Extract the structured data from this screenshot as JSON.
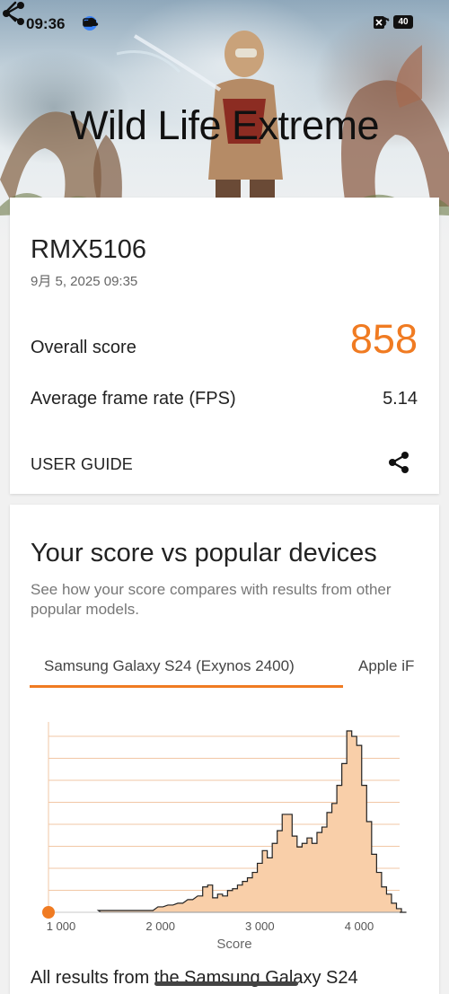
{
  "status_bar": {
    "time": "09:36",
    "left_badge": "GT",
    "right_gt": "GT",
    "battery": "40",
    "icons": [
      "video-camera-icon",
      "gt-badge-icon",
      "cloud-icon",
      "vibrate-icon",
      "wifi-icon",
      "sim-off-icon",
      "battery-icon"
    ]
  },
  "hero": {
    "title": "Wild Life Extreme"
  },
  "result_card": {
    "device": "RMX5106",
    "date": "9月 5, 2025 09:35",
    "overall_label": "Overall score",
    "overall_value": "858",
    "fps_label": "Average frame rate (FPS)",
    "fps_value": "5.14",
    "user_guide": "USER GUIDE"
  },
  "compare_card": {
    "title": "Your score vs popular devices",
    "subtitle": "See how your score compares with results from other popular models.",
    "tabs": [
      "Samsung Galaxy S24 (Exynos 2400)",
      "Apple iF"
    ],
    "active_tab": 0,
    "footer_text": "All results from the Samsung Galaxy S24"
  },
  "colors": {
    "accent": "#f07b22",
    "histogram_fill": "#f9cfa9",
    "histogram_stroke": "#222222",
    "grid": "#f2c7a5"
  },
  "chart_data": {
    "type": "area",
    "xlabel": "Score",
    "x_ticks": [
      "1 000",
      "2 000",
      "3 000",
      "4 000"
    ],
    "xlim": [
      0,
      4600
    ],
    "ylim": [
      0,
      100
    ],
    "marker": {
      "label": "your-score",
      "x": 858
    },
    "x": [
      1400,
      1500,
      1600,
      1700,
      1800,
      1900,
      2000,
      2100,
      2200,
      2300,
      2400,
      2450,
      2500,
      2550,
      2600,
      2650,
      2700,
      2750,
      2800,
      2850,
      2900,
      2950,
      3000,
      3050,
      3100,
      3150,
      3200,
      3250,
      3300,
      3350,
      3400,
      3450,
      3500,
      3550,
      3600,
      3650,
      3700,
      3750,
      3800,
      3850,
      3900,
      3950,
      4000,
      4050,
      4100,
      4150,
      4200,
      4250,
      4300,
      4350,
      4400,
      4450
    ],
    "y": [
      1,
      1,
      1,
      1,
      1,
      1,
      3,
      4,
      5,
      7,
      9,
      14,
      15,
      8,
      10,
      9,
      12,
      13,
      15,
      17,
      19,
      22,
      27,
      34,
      30,
      38,
      45,
      54,
      54,
      42,
      36,
      38,
      41,
      38,
      44,
      47,
      55,
      60,
      70,
      82,
      100,
      97,
      92,
      70,
      50,
      32,
      22,
      14,
      10,
      5,
      2,
      0
    ]
  }
}
